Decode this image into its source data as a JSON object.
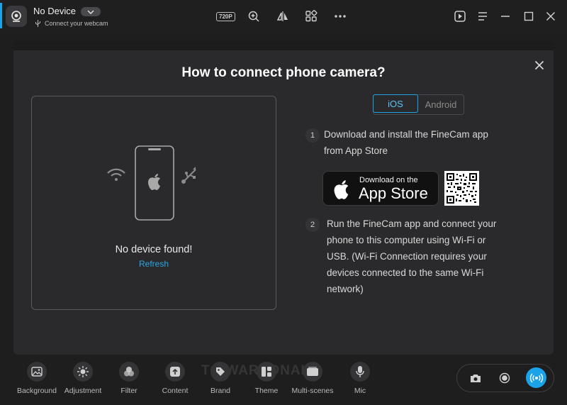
{
  "header": {
    "device_name": "No Device",
    "device_sub": "Connect your webcam",
    "resolution_badge": "720P"
  },
  "dialog": {
    "title": "How to connect phone camera?",
    "status_text": "No device found!",
    "refresh_label": "Refresh",
    "tabs": {
      "ios": "iOS",
      "android": "Android",
      "selected": "iOS"
    },
    "steps": [
      {
        "num": "1",
        "lines": [
          "Download and install the FineCam app",
          "from App Store"
        ]
      },
      {
        "num": "2",
        "lines": [
          "Run the FineCam app and connect your",
          "phone to this computer using Wi-Fi or",
          "USB. (Wi-Fi Connection requires your",
          "devices connected to the same Wi-Fi",
          "network)"
        ]
      }
    ],
    "appstore": {
      "small": "Download on the",
      "big": "App Store"
    }
  },
  "toolbar": {
    "items": [
      {
        "label": "Background",
        "icon": "image-icon"
      },
      {
        "label": "Adjustment",
        "icon": "brightness-icon"
      },
      {
        "label": "Filter",
        "icon": "filter-icon"
      },
      {
        "label": "Content",
        "icon": "upload-icon"
      },
      {
        "label": "Brand",
        "icon": "tag-icon"
      },
      {
        "label": "Theme",
        "icon": "theme-icon"
      },
      {
        "label": "Multi-scenes",
        "icon": "scene-icon"
      },
      {
        "label": "Mic",
        "icon": "mic-icon"
      }
    ],
    "watermark": "TO WAREONALP"
  },
  "colors": {
    "accent": "#1aa3e8",
    "background": "#1e1e1f",
    "panel": "#2a2a2c"
  }
}
